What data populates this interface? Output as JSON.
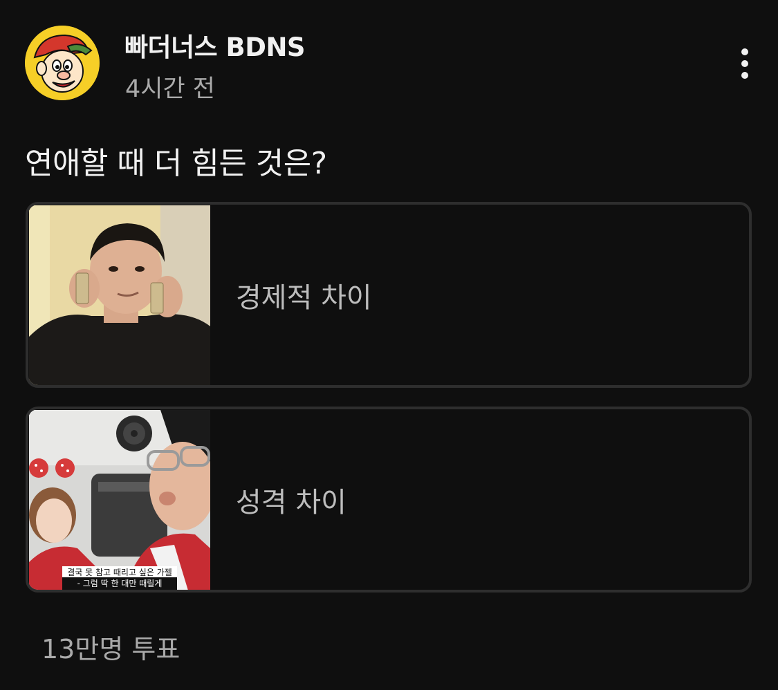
{
  "post": {
    "channel_name": "빠더너스 BDNS",
    "timestamp": "4시간 전",
    "question": "연애할 때 더 힘든 것은?",
    "vote_count": "13만명 투표"
  },
  "poll": {
    "options": [
      {
        "label": "경제적 차이"
      },
      {
        "label": "성격 차이",
        "caption_line1": "결국 못 참고 때리고 싶은 가젤",
        "caption_line2": "- 그럼 딱 한 대만 때릴게"
      }
    ]
  },
  "icons": {
    "more": "more-vert-icon",
    "avatar": "channel-avatar"
  },
  "colors": {
    "background": "#0f0f0f",
    "text_primary": "#f1f1f1",
    "text_secondary": "#aaaaaa",
    "option_border": "#2e2e2e",
    "avatar_bg": "#f6cf27"
  }
}
